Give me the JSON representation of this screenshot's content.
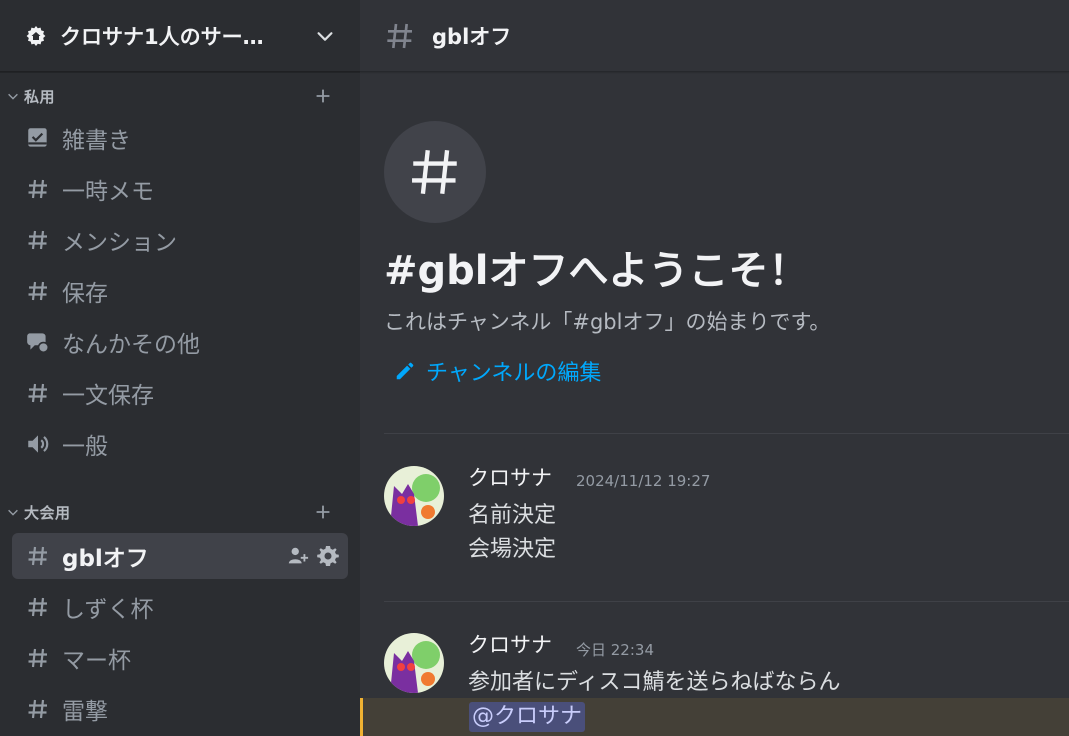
{
  "server": {
    "name": "クロサナ1人のサー…",
    "icon": "home-shield-icon"
  },
  "categories": [
    {
      "label": "私用",
      "add_icon": "plus-icon"
    },
    {
      "label": "大会用",
      "add_icon": "plus-icon"
    }
  ],
  "channels_private": [
    {
      "label": "雑書き",
      "icon": "forum-icon"
    },
    {
      "label": "一時メモ",
      "icon": "hash-icon"
    },
    {
      "label": "メンション",
      "icon": "hash-icon"
    },
    {
      "label": "保存",
      "icon": "hash-icon"
    },
    {
      "label": "なんかその他",
      "icon": "thread-chat-icon"
    },
    {
      "label": "一文保存",
      "icon": "hash-icon"
    },
    {
      "label": "一般",
      "icon": "speaker-icon"
    }
  ],
  "channels_tournament": [
    {
      "label": "gblオフ",
      "icon": "hash-icon",
      "active": true
    },
    {
      "label": "しずく杯",
      "icon": "hash-icon"
    },
    {
      "label": "マー杯",
      "icon": "hash-icon"
    },
    {
      "label": "雷撃",
      "icon": "hash-icon"
    }
  ],
  "topbar": {
    "channel_name": "gblオフ"
  },
  "welcome": {
    "title": "#gblオフへようこそ！",
    "subtitle": "これはチャンネル「#gblオフ」の始まりです。",
    "edit_link": "チャンネルの編集"
  },
  "messages": [
    {
      "author": "クロサナ",
      "timestamp": "2024/11/12 19:27",
      "lines": [
        "名前決定",
        "会場決定"
      ]
    },
    {
      "author": "クロサナ",
      "timestamp": "今日 22:34",
      "lines": [
        "参加者にディスコ鯖を送らねばならん"
      ],
      "mention": "@クロサナ"
    }
  ],
  "colors": {
    "sidebar_bg": "#2b2d31",
    "main_bg": "#313338",
    "link": "#00a8fc",
    "mention_highlight": "#f0b232"
  }
}
